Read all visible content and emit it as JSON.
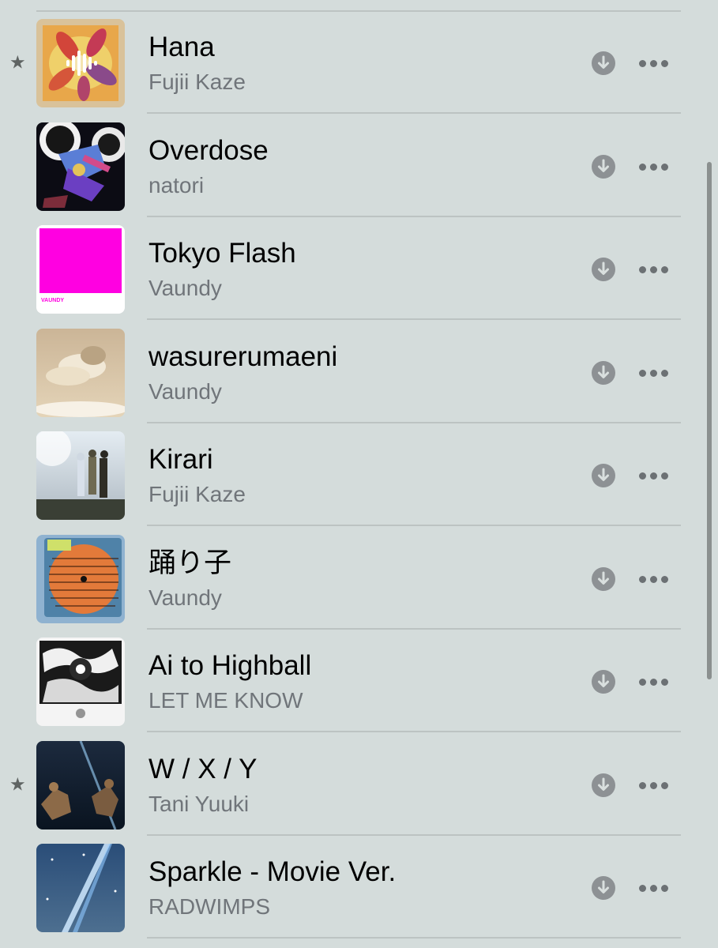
{
  "songs": [
    {
      "title": "Hana",
      "artist": "Fujii Kaze",
      "starred": true,
      "now_playing": true,
      "art_icon": "hana-album-art"
    },
    {
      "title": "Overdose",
      "artist": "natori",
      "starred": false,
      "now_playing": false,
      "art_icon": "overdose-album-art"
    },
    {
      "title": "Tokyo Flash",
      "artist": "Vaundy",
      "starred": false,
      "now_playing": false,
      "art_icon": "tokyo-flash-album-art"
    },
    {
      "title": "wasurerumaeni",
      "artist": "Vaundy",
      "starred": false,
      "now_playing": false,
      "art_icon": "wasurerumaeni-album-art"
    },
    {
      "title": "Kirari",
      "artist": "Fujii Kaze",
      "starred": false,
      "now_playing": false,
      "art_icon": "kirari-album-art"
    },
    {
      "title": "踊り子",
      "artist": "Vaundy",
      "starred": false,
      "now_playing": false,
      "art_icon": "odoriko-album-art"
    },
    {
      "title": "Ai to Highball",
      "artist": "LET ME KNOW",
      "starred": false,
      "now_playing": false,
      "art_icon": "ai-to-highball-album-art"
    },
    {
      "title": "W / X / Y",
      "artist": "Tani Yuuki",
      "starred": true,
      "now_playing": false,
      "art_icon": "wxy-album-art"
    },
    {
      "title": "Sparkle - Movie Ver.",
      "artist": "RADWIMPS",
      "starred": false,
      "now_playing": false,
      "art_icon": "sparkle-album-art"
    }
  ],
  "icons": {
    "star": "★",
    "download": "download-icon",
    "more": "more-icon"
  },
  "colors": {
    "background": "#d4dcdb",
    "title": "#000000",
    "subtitle": "#70757a",
    "icon_gray": "#8d9194"
  }
}
